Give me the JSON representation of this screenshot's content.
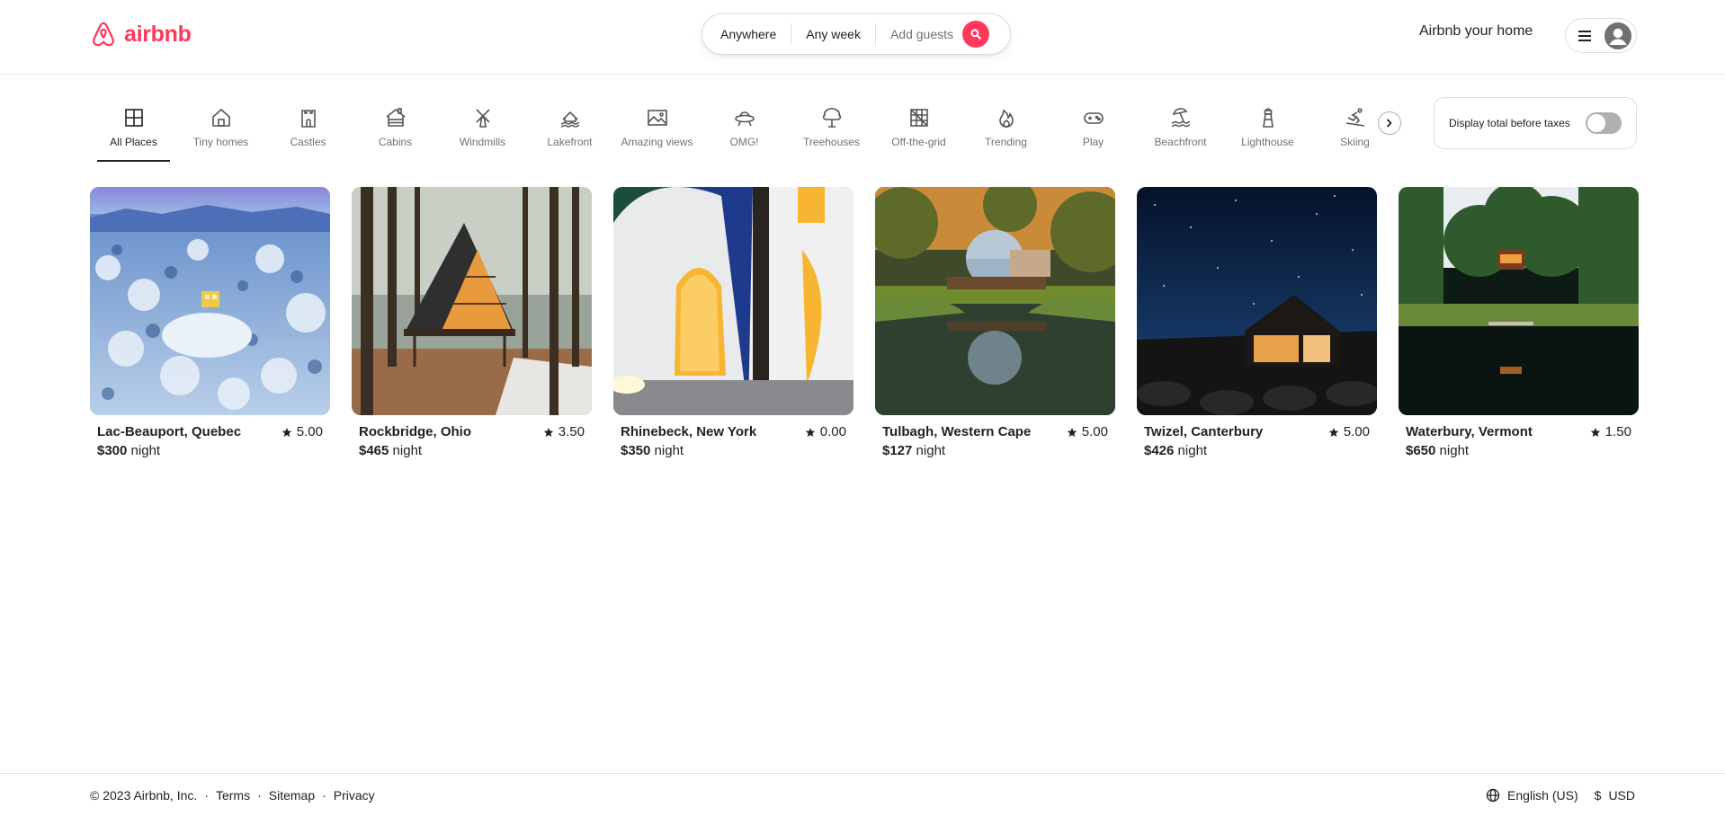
{
  "brand": {
    "name": "airbnb",
    "color": "#ff385c"
  },
  "search": {
    "anywhere": "Anywhere",
    "any_week": "Any week",
    "guests": "Add guests"
  },
  "header": {
    "host_link": "Airbnb your home"
  },
  "categories": [
    {
      "label": "All Places",
      "icon": "grid-icon",
      "active": true
    },
    {
      "label": "Tiny homes",
      "icon": "tiny-home-icon"
    },
    {
      "label": "Castles",
      "icon": "castle-icon"
    },
    {
      "label": "Cabins",
      "icon": "cabin-icon"
    },
    {
      "label": "Windmills",
      "icon": "windmill-icon"
    },
    {
      "label": "Lakefront",
      "icon": "lakefront-icon"
    },
    {
      "label": "Amazing views",
      "icon": "amazing-views-icon"
    },
    {
      "label": "OMG!",
      "icon": "ufo-icon"
    },
    {
      "label": "Treehouses",
      "icon": "treehouse-icon"
    },
    {
      "label": "Off-the-grid",
      "icon": "off-grid-icon"
    },
    {
      "label": "Trending",
      "icon": "flame-icon"
    },
    {
      "label": "Play",
      "icon": "gamepad-icon"
    },
    {
      "label": "Beachfront",
      "icon": "beach-icon"
    },
    {
      "label": "Lighthouse",
      "icon": "lighthouse-icon"
    },
    {
      "label": "Skiing",
      "icon": "skiing-icon"
    }
  ],
  "tax_toggle": {
    "label": "Display total before taxes",
    "on": false
  },
  "listings": [
    {
      "location": "Lac-Beauport, Quebec",
      "rating": "5.00",
      "price": "$300",
      "unit": "night"
    },
    {
      "location": "Rockbridge, Ohio",
      "rating": "3.50",
      "price": "$465",
      "unit": "night"
    },
    {
      "location": "Rhinebeck, New York",
      "rating": "0.00",
      "price": "$350",
      "unit": "night"
    },
    {
      "location": "Tulbagh, Western Cape",
      "rating": "5.00",
      "price": "$127",
      "unit": "night"
    },
    {
      "location": "Twizel, Canterbury",
      "rating": "5.00",
      "price": "$426",
      "unit": "night"
    },
    {
      "location": "Waterbury, Vermont",
      "rating": "1.50",
      "price": "$650",
      "unit": "night"
    }
  ],
  "footer": {
    "copyright": "© 2023 Airbnb, Inc.",
    "sep": "·",
    "terms": "Terms",
    "sitemap": "Sitemap",
    "privacy": "Privacy",
    "language": "English (US)",
    "currency_symbol": "$",
    "currency": "USD"
  }
}
